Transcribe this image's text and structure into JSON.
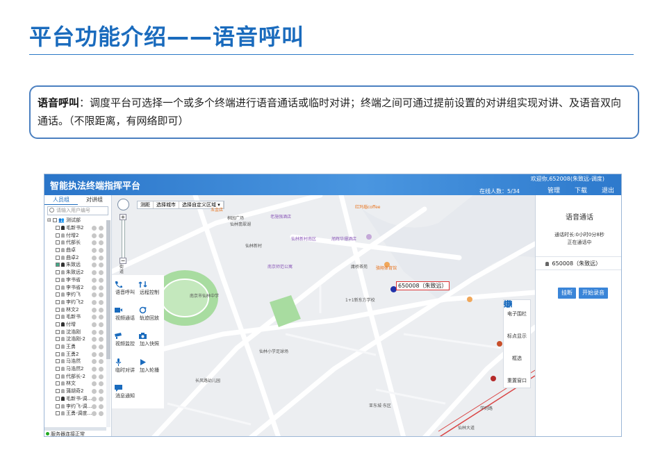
{
  "slide": {
    "title": "平台功能介绍——语音呼叫",
    "desc_label": "语音呼叫",
    "desc_text": "：调度平台可选择一个或多个终端进行语音通话或临时对讲；终端之间可通过提前设置的对讲组实现对讲、及语音双向通话。（不限距离，有网络即可）"
  },
  "app": {
    "title": "智能执法终端指挥平台",
    "welcome": "欢迎你,652008(朱致远-调度)",
    "online": "在线人数：5/34",
    "nav": {
      "manage": "管理",
      "download": "下载",
      "logout": "退出"
    }
  },
  "left": {
    "tab_people": "人员组",
    "tab_talk": "对讲组",
    "search_placeholder": "请输入用户编号",
    "root": "测试部",
    "members": [
      {
        "name": "毛新书2",
        "checked": false,
        "online": true
      },
      {
        "name": "付增2",
        "checked": false,
        "online": false
      },
      {
        "name": "代部长",
        "checked": false,
        "online": false
      },
      {
        "name": "曲卓",
        "checked": false,
        "online": false
      },
      {
        "name": "曲卓2",
        "checked": false,
        "online": false
      },
      {
        "name": "朱致远",
        "checked": true,
        "online": true
      },
      {
        "name": "朱致远2",
        "checked": false,
        "online": false
      },
      {
        "name": "李书省",
        "checked": false,
        "online": false
      },
      {
        "name": "李书省2",
        "checked": false,
        "online": false
      },
      {
        "name": "李约飞",
        "checked": false,
        "online": false
      },
      {
        "name": "李约飞2",
        "checked": false,
        "online": false
      },
      {
        "name": "林文2",
        "checked": false,
        "online": false
      },
      {
        "name": "毛新书",
        "checked": false,
        "online": false
      },
      {
        "name": "付增",
        "checked": false,
        "online": true
      },
      {
        "name": "沈浩刚",
        "checked": false,
        "online": false
      },
      {
        "name": "沈浩刚-2",
        "checked": false,
        "online": false
      },
      {
        "name": "王勇",
        "checked": false,
        "online": false
      },
      {
        "name": "王勇2",
        "checked": false,
        "online": false
      },
      {
        "name": "马浩然",
        "checked": false,
        "online": false
      },
      {
        "name": "马浩然2",
        "checked": false,
        "online": false
      },
      {
        "name": "代部长-2",
        "checked": false,
        "online": false
      },
      {
        "name": "林文",
        "checked": false,
        "online": false
      },
      {
        "name": "蒲胡奇2",
        "checked": false,
        "online": false
      },
      {
        "name": "毛新书-调...",
        "checked": false,
        "online": true
      },
      {
        "name": "李约飞-调...",
        "checked": false,
        "online": false
      },
      {
        "name": "王勇-调度...",
        "checked": false,
        "online": false
      }
    ],
    "status": "服务器连接正常"
  },
  "map": {
    "toolbar": [
      "测距",
      "选择城市",
      "选择自定义区域 ▾"
    ],
    "zoom_level": "街道",
    "target_label": "650008（朱致远）",
    "labels": [
      {
        "t": "五金店",
        "c": "orange"
      },
      {
        "t": "老施强酒店",
        "c": "purple"
      },
      {
        "t": "红玛瑙coffee",
        "c": "orange"
      },
      {
        "t": "桐园广场",
        "c": ""
      },
      {
        "t": "仙林翡翠湖",
        "c": ""
      },
      {
        "t": "仙林新村",
        "c": ""
      },
      {
        "t": "仙林新村南区",
        "c": "purple"
      },
      {
        "t": "旭辉华珊酒店",
        "c": "purple"
      },
      {
        "t": "南京师范公寓",
        "c": "purple"
      },
      {
        "t": "庸桥茶苑",
        "c": ""
      },
      {
        "t": "骆翔体育馆",
        "c": "orange"
      },
      {
        "t": "南京市仙林中学",
        "c": ""
      },
      {
        "t": "1+1新东方学校",
        "c": ""
      },
      {
        "t": "仙林小学足球场",
        "c": ""
      },
      {
        "t": "长风路幼儿园",
        "c": ""
      },
      {
        "t": "亚东城·东区",
        "c": ""
      },
      {
        "t": "仙林大道",
        "c": ""
      },
      {
        "t": "学则路",
        "c": ""
      }
    ]
  },
  "functions": [
    {
      "label": "语音呼叫",
      "icon": "phone-icon"
    },
    {
      "label": "远程控制",
      "icon": "remote-control-icon"
    },
    {
      "label": "视频通话",
      "icon": "video-call-icon"
    },
    {
      "label": "轨迹回放",
      "icon": "track-replay-icon"
    },
    {
      "label": "视频监控",
      "icon": "cctv-icon"
    },
    {
      "label": "加入快照",
      "icon": "camera-icon"
    },
    {
      "label": "临时对讲",
      "icon": "microphone-icon"
    },
    {
      "label": "加入轮播",
      "icon": "play-icon"
    },
    {
      "label": "消息通知",
      "icon": "message-icon"
    }
  ],
  "right_tools": [
    {
      "label": "电子围栏",
      "icon": "fence-icon"
    },
    {
      "label": "标点显示",
      "icon": "plus-icon"
    },
    {
      "label": "框选",
      "icon": "select-box-icon"
    },
    {
      "label": "重置窗口",
      "icon": "reset-icon"
    }
  ],
  "call_panel": {
    "title": "语音通话",
    "duration": "通话时长:0小时0分8秒",
    "status": "正在通话中",
    "user": "650008（朱致远）",
    "hangup": "挂断",
    "record": "开始录音"
  }
}
